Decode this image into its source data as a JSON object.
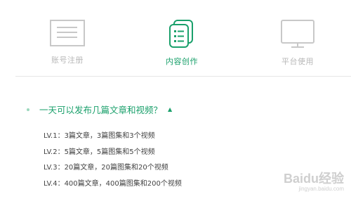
{
  "tabs": [
    {
      "label": "账号注册",
      "icon": "document-icon",
      "active": false
    },
    {
      "label": "内容创作",
      "icon": "notes-icon",
      "active": true
    },
    {
      "label": "平台使用",
      "icon": "monitor-icon",
      "active": false
    }
  ],
  "faq": {
    "question": "一天可以发布几篇文章和视频？",
    "expanded_icon": "caret-up-icon",
    "answers": [
      "LV.1：3篇文章，3篇图集和3个视频",
      "LV.2：5篇文章，5篇图集和5个视频",
      "LV.3：20篇文章，20篇图集和20个视频",
      "LV.4：400篇文章，400篇图集和200个视频"
    ]
  },
  "watermark": {
    "brand": "Baidu经验",
    "url": "jingyan.baidu.com"
  },
  "colors": {
    "accent": "#1aa06b",
    "inactive": "#b8b8b8"
  }
}
